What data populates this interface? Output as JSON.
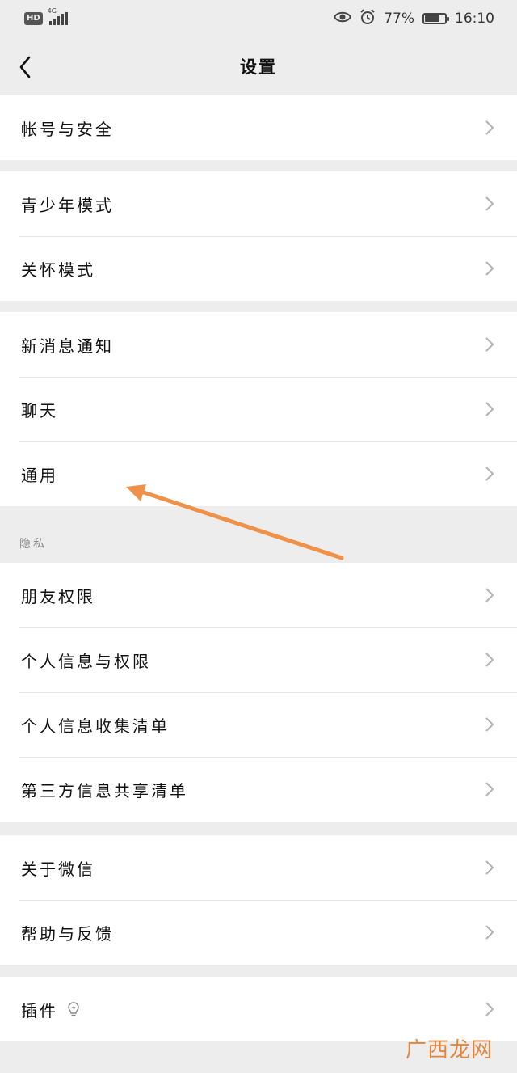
{
  "status_bar": {
    "hd": "HD",
    "network": "4G",
    "battery_percent": "77%",
    "battery_level": 0.77,
    "time": "16:10"
  },
  "nav": {
    "title": "设置"
  },
  "groups": [
    {
      "items": [
        {
          "label": "帐号与安全"
        }
      ]
    },
    {
      "items": [
        {
          "label": "青少年模式"
        },
        {
          "label": "关怀模式"
        }
      ]
    },
    {
      "items": [
        {
          "label": "新消息通知"
        },
        {
          "label": "聊天"
        },
        {
          "label": "通用"
        }
      ]
    }
  ],
  "privacy": {
    "section_label": "隐私",
    "items": [
      {
        "label": "朋友权限"
      },
      {
        "label": "个人信息与权限"
      },
      {
        "label": "个人信息收集清单"
      },
      {
        "label": "第三方信息共享清单"
      }
    ]
  },
  "about_group": {
    "items": [
      {
        "label": "关于微信"
      },
      {
        "label": "帮助与反馈"
      }
    ]
  },
  "plugin_group": {
    "items": [
      {
        "label": "插件",
        "icon": "lightbulb-icon"
      }
    ]
  },
  "annotation": {
    "arrow_color": "#f0914a"
  },
  "watermark": "广西龙网"
}
